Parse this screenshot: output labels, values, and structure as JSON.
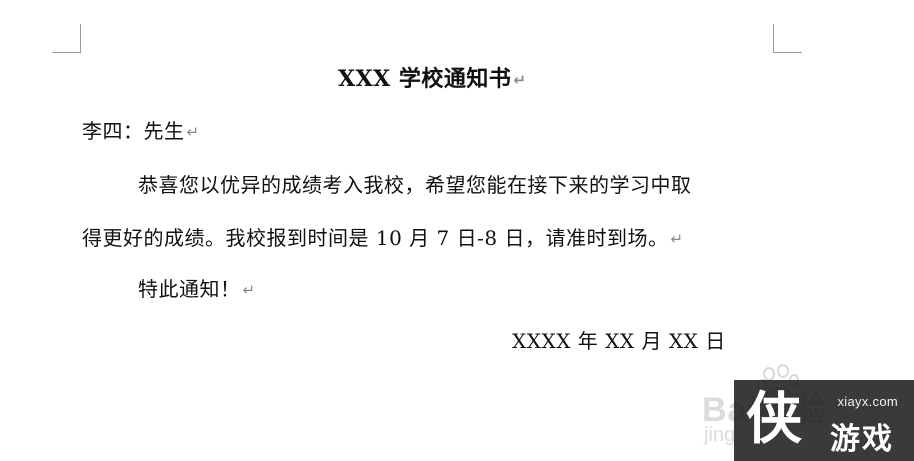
{
  "document": {
    "title": "XXX 学校通知书",
    "salutation": "李四：先生",
    "paragraph_line1": "恭喜您以优异的成绩考入我校，希望您能在接下来的学习中取",
    "paragraph_line2": "得更好的成绩。我校报到时间是 10 月 7 日-8 日，请准时到场。",
    "closing": "特此通知！",
    "date": "XXXX 年 XX 月 XX 日",
    "paragraph_mark": "↵"
  },
  "watermark": {
    "baidu_text": "Bai",
    "baidu_suffix": "经验",
    "jingyan": "jing"
  },
  "logo": {
    "url": "xiayx.com",
    "big_char": "侠",
    "name": "游戏"
  },
  "colors": {
    "text": "#111111",
    "paragraph_mark": "#8a8a8a",
    "logo_bg": "#1a1a1a",
    "crop_marks": "#9a9a9a"
  }
}
